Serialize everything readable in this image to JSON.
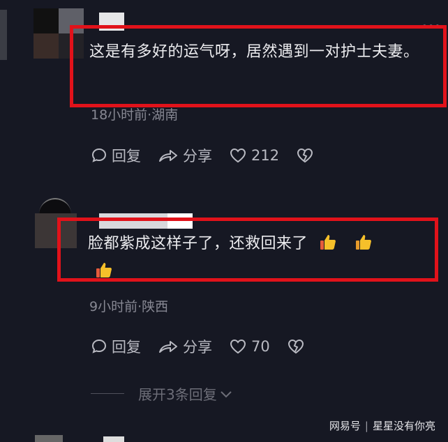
{
  "comments": [
    {
      "text": "这是有多好的运气呀，居然遇到一对护士夫妻。",
      "meta": "18小时前·湖南",
      "reply_label": "回复",
      "share_label": "分享",
      "likes": "212"
    },
    {
      "text": "脸都紫成这样子了，还救回来了",
      "meta": "9小时前·陕西",
      "reply_label": "回复",
      "share_label": "分享",
      "likes": "70"
    }
  ],
  "expand_label": "展开3条回复",
  "watermark": {
    "brand": "网易号",
    "author": "星星没有你亮"
  },
  "colors": {
    "background": "#161823",
    "highlight_box": "#e1121a",
    "thumb": "#f6c02a"
  },
  "icons": [
    "comment-icon",
    "share-icon",
    "heart-icon",
    "broken-heart-icon",
    "thumbs-up-icon",
    "chevron-down-icon"
  ]
}
